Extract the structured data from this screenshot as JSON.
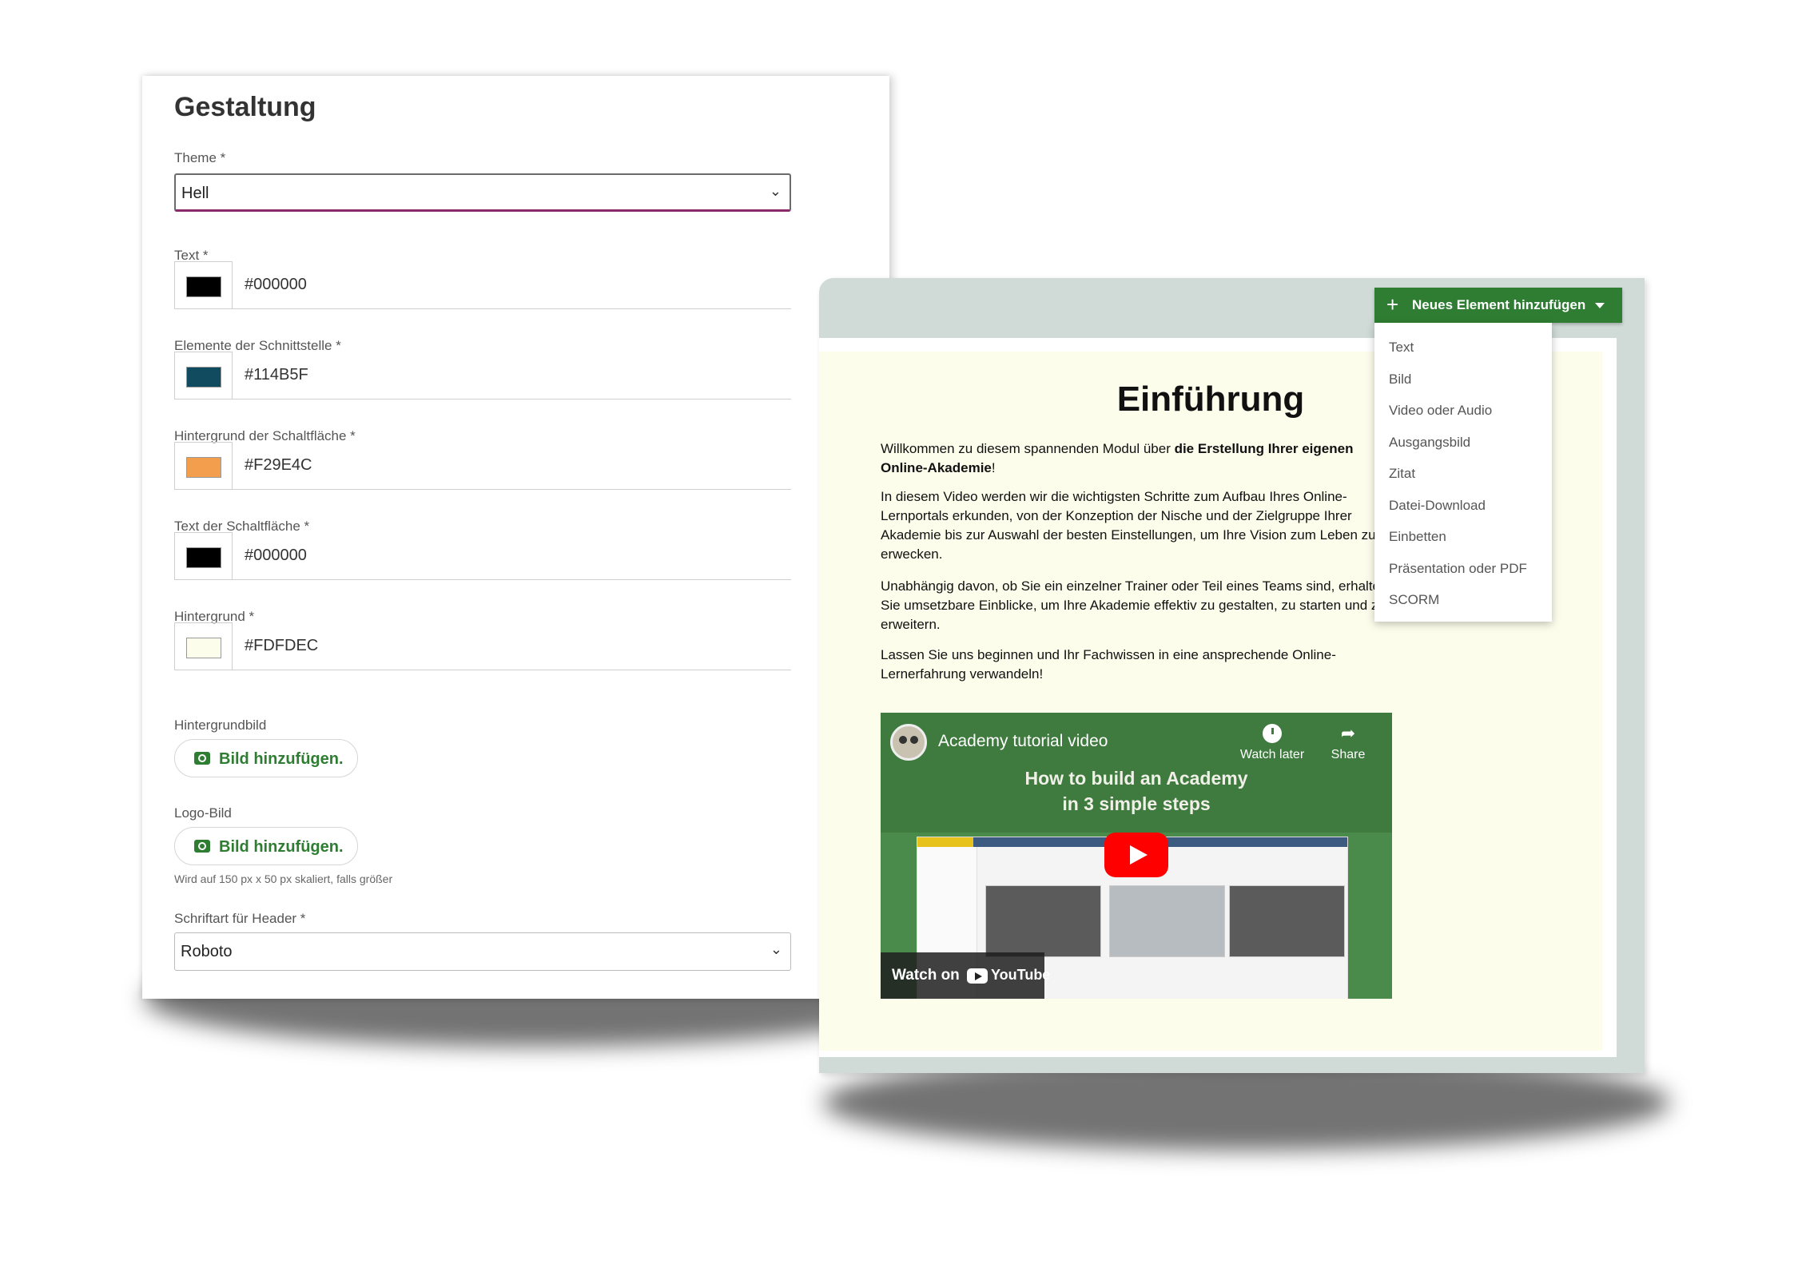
{
  "design_panel": {
    "title": "Gestaltung",
    "theme": {
      "label": "Theme *",
      "value": "Hell"
    },
    "colors": [
      {
        "label": "Text *",
        "value": "#000000",
        "swatch": "#000000"
      },
      {
        "label": "Elemente der Schnittstelle *",
        "value": "#114B5F",
        "swatch": "#114B5F"
      },
      {
        "label": "Hintergrund der Schaltfläche *",
        "value": "#F29E4C",
        "swatch": "#F29E4C"
      },
      {
        "label": "Text der Schaltfläche *",
        "value": "#000000",
        "swatch": "#000000"
      },
      {
        "label": "Hintergrund *",
        "value": "#FDFDEC",
        "swatch": "#FDFDEC"
      }
    ],
    "background_image": {
      "label": "Hintergrundbild",
      "button": "Bild hinzufügen."
    },
    "logo_image": {
      "label": "Logo-Bild",
      "button": "Bild hinzufügen.",
      "hint": "Wird auf 150 px x 50 px skaliert, falls größer"
    },
    "header_font": {
      "label": "Schriftart für Header *",
      "value": "Roboto"
    }
  },
  "editor": {
    "add_button": "Neues Element hinzufügen",
    "menu_items": [
      "Text",
      "Bild",
      "Video oder Audio",
      "Ausgangsbild",
      "Zitat",
      "Datei-Download",
      "Einbetten",
      "Präsentation oder PDF",
      "SCORM"
    ],
    "content": {
      "title": "Einführung",
      "p1_pre": "Willkommen zu diesem spannenden Modul über ",
      "p1_bold": "die Erstellung Ihrer eigenen Online-Akademie",
      "p1_post": "!",
      "p2": "In diesem Video werden wir die wichtigsten Schritte zum Aufbau Ihres Online-Lernportals erkunden, von der Konzeption der Nische und der Zielgruppe Ihrer Akademie bis zur Auswahl der besten Einstellungen, um Ihre Vision zum Leben zu erwecken.",
      "p3": "Unabhängig davon, ob Sie ein einzelner Trainer oder Teil eines Teams sind, erhalten Sie umsetzbare Einblicke, um Ihre Akademie effektiv zu gestalten, zu starten und zu erweitern.",
      "p4": "Lassen Sie uns beginnen und Ihr Fachwissen in eine ansprechende Online-Lernerfahrung verwandeln!"
    },
    "video": {
      "title": "Academy tutorial video",
      "headline_line1": "How to build an Academy",
      "headline_line2": "in 3 simple steps",
      "watch_later": "Watch later",
      "share": "Share",
      "watch_on": "Watch on",
      "platform": "YouTube"
    }
  }
}
